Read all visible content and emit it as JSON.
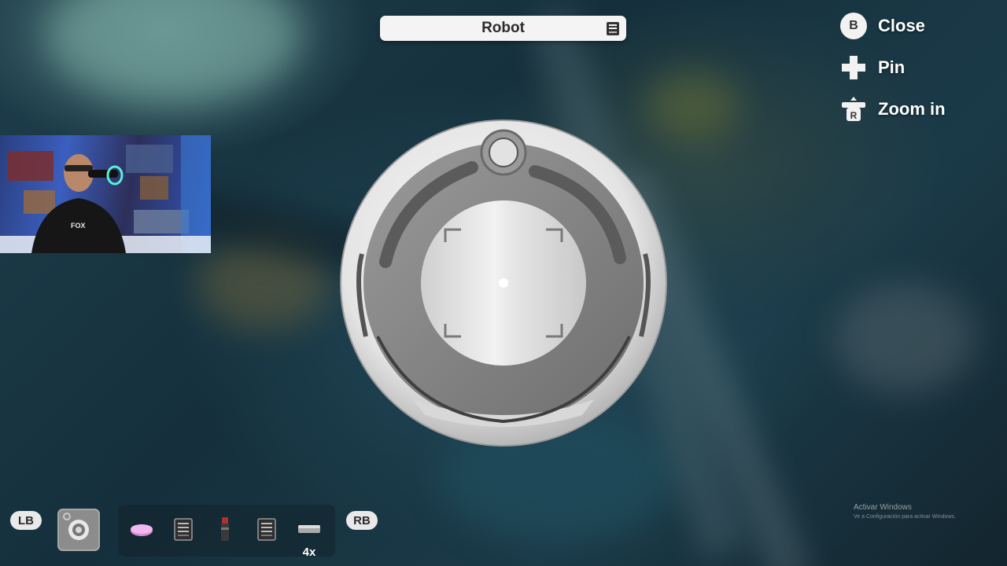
{
  "header": {
    "title": "Robot"
  },
  "controls": [
    {
      "key": "B",
      "label": "Close",
      "icon": "b-button-icon"
    },
    {
      "key": "+",
      "label": "Pin",
      "icon": "dpad-icon"
    },
    {
      "key": "R",
      "label": "Zoom in",
      "icon": "right-stick-press-icon"
    }
  ],
  "hotbar": {
    "left_bumper": "LB",
    "right_bumper": "RB",
    "selected_item": "robot-item-icon",
    "items": [
      {
        "icon": "pink-disc-item-icon"
      },
      {
        "icon": "data-drive-item-icon"
      },
      {
        "icon": "red-canister-item-icon"
      },
      {
        "icon": "data-drive-item-icon"
      },
      {
        "icon": "metal-bar-item-icon",
        "count": "4x"
      }
    ]
  },
  "watermark": {
    "line1": "Activar Windows",
    "line2": "Ve a Configuración para activar Windows."
  },
  "colors": {
    "title_bar_bg": "#f4f4f4",
    "text_primary": "#ffffff",
    "robot_body": "#8a8a8a"
  }
}
